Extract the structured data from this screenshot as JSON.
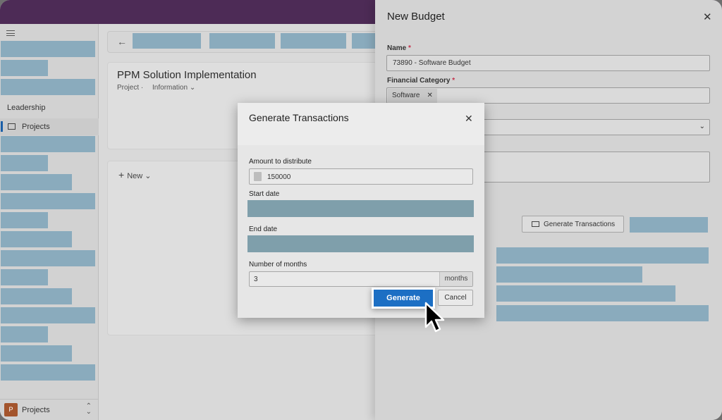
{
  "side_panel": {
    "title": "New Budget",
    "close_icon": "close-icon",
    "name_label": "Name",
    "name_value": "73890 - Software Budget",
    "category_label": "Financial Category",
    "category_chip": "Software",
    "generate_transactions_label": "Generate Transactions"
  },
  "main": {
    "title": "PPM Solution Implementation",
    "entity": "Project",
    "view": "Information",
    "new_label": "New"
  },
  "nav": {
    "heading": "Leadership",
    "active_item": "Projects",
    "area_tile": "P",
    "area_label": "Projects"
  },
  "dialog": {
    "title": "Generate Transactions",
    "amount_label": "Amount to distribute",
    "amount_value": "150000",
    "start_label": "Start date",
    "end_label": "End date",
    "months_label": "Number of months",
    "months_value": "3",
    "months_suffix": "months",
    "generate_label": "Generate",
    "cancel_label": "Cancel"
  },
  "colors": {
    "accent": "#1c6fc4",
    "topbar": "#4d2b56",
    "redacted": "#8aabbd"
  }
}
